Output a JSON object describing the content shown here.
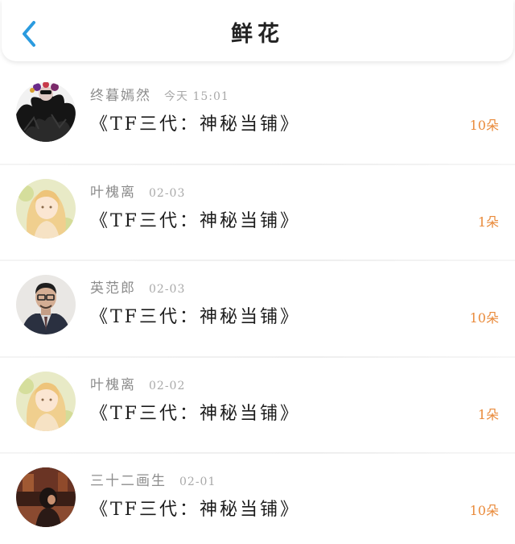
{
  "header": {
    "title": "鲜花",
    "back_icon": "chevron-left-icon",
    "accent_color": "#2b9bdf"
  },
  "records": [
    {
      "user": "终暮嫣然",
      "time": "今天 15:01",
      "work": "《TF三代：神秘当铺》",
      "count": "10朵",
      "avatar": "dark-feather-mask"
    },
    {
      "user": "叶槐离",
      "time": "02-03",
      "work": "《TF三代：神秘当铺》",
      "count": "1朵",
      "avatar": "anime-blonde-girl"
    },
    {
      "user": "英范郎",
      "time": "02-03",
      "work": "《TF三代：神秘当铺》",
      "count": "10朵",
      "avatar": "man-glasses-suit"
    },
    {
      "user": "叶槐离",
      "time": "02-02",
      "work": "《TF三代：神秘当铺》",
      "count": "1朵",
      "avatar": "anime-blonde-girl"
    },
    {
      "user": "三十二画生",
      "time": "02-01",
      "work": "《TF三代：神秘当铺》",
      "count": "10朵",
      "avatar": "red-room-portrait"
    }
  ],
  "colors": {
    "count": "#e98a3a",
    "username": "#8d8d8d",
    "time": "#a9a9a9"
  }
}
